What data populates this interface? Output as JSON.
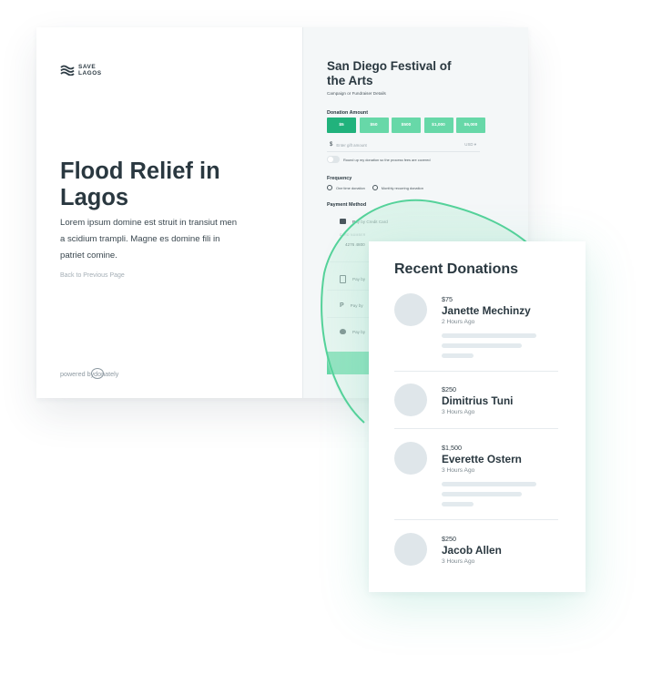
{
  "brand": {
    "logo_line1": "SAVE",
    "logo_line2": "LAGOS"
  },
  "hero": {
    "title": "Flood Relief in Lagos",
    "description": "Lorem ipsum domine est struit in transiut men a scidium trampli. Magne es domine fili in patriet comine.",
    "back_link": "Back to Previous Page",
    "powered_prefix": "powered by ",
    "powered_brand": "donately"
  },
  "form": {
    "event_title": "San Diego Festival of the Arts",
    "event_subtitle": "Campaign or Fundraiser Details",
    "donation_amount_label": "Donation Amount",
    "amounts": [
      "$5",
      "$50",
      "$500",
      "$1,000",
      "$5,000"
    ],
    "selected_amount": "$5",
    "gift_symbol": "$",
    "gift_placeholder": "Enter gift amount",
    "currency": "USD ▾",
    "roundup_text": "Round up my donation so the process fees are covered",
    "frequency_label": "Frequency",
    "frequency_options": [
      "One time donation",
      "Monthly recurring donation"
    ],
    "payment_method_label": "Payment Method",
    "payment_credit_card": "Pay by Credit Card",
    "card_number_label": "CARD NUMBER",
    "card_number_value": "4276 4800",
    "pay_by": "Pay by",
    "accent_color": "#67d8a8",
    "selected_color": "#21b27c"
  },
  "recent": {
    "title": "Recent Donations",
    "donations": [
      {
        "amount": "$75",
        "name": "Janette Mechinzy",
        "time": "2 Hours Ago"
      },
      {
        "amount": "$250",
        "name": "Dimitrius Tuni",
        "time": "3 Hours Ago"
      },
      {
        "amount": "$1,500",
        "name": "Everette Ostern",
        "time": "3 Hours Ago"
      },
      {
        "amount": "$250",
        "name": "Jacob Allen",
        "time": "3 Hours Ago"
      }
    ]
  }
}
